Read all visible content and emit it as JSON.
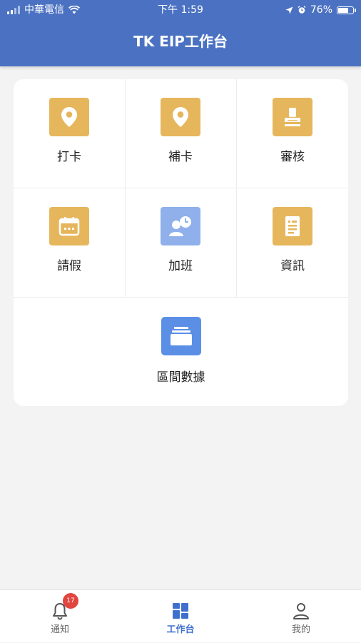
{
  "status_bar": {
    "carrier": "中華電信",
    "time": "下午 1:59",
    "battery": "76%",
    "battery_level": 0.76
  },
  "header": {
    "title": "TK EIP工作台"
  },
  "menu": {
    "items": [
      {
        "label": "打卡",
        "icon": "location-pin-icon",
        "color": "#e6b65c"
      },
      {
        "label": "補卡",
        "icon": "location-pin-icon",
        "color": "#e6b65c"
      },
      {
        "label": "審核",
        "icon": "stamp-icon",
        "color": "#e6b65c"
      },
      {
        "label": "請假",
        "icon": "calendar-icon",
        "color": "#e6b65c"
      },
      {
        "label": "加班",
        "icon": "user-clock-icon",
        "color": "#8fb0ea"
      },
      {
        "label": "資訊",
        "icon": "document-icon",
        "color": "#e6b65c"
      }
    ],
    "wide_item": {
      "label": "區間數據",
      "icon": "folder-stack-icon",
      "color": "#5b8fe6"
    }
  },
  "tabbar": {
    "tabs": [
      {
        "label": "通知",
        "icon": "bell-icon"
      },
      {
        "label": "工作台",
        "icon": "dashboard-icon"
      },
      {
        "label": "我的",
        "icon": "user-icon"
      }
    ],
    "notification_badge": "17",
    "active_color": "#3f6fce"
  },
  "colors": {
    "header_bg": "#4b72c2",
    "page_bg": "#f3f3f3",
    "badge": "#e0463f"
  }
}
